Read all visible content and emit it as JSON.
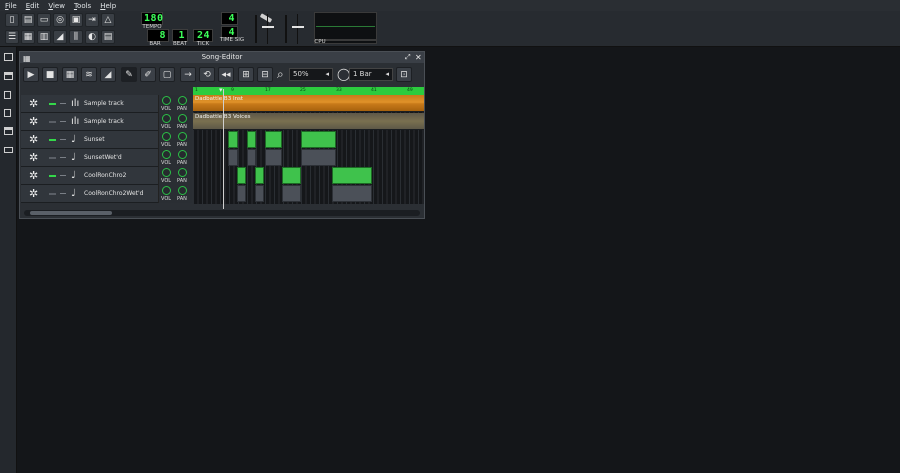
{
  "menu": [
    {
      "pre": "",
      "ul": "F",
      "post": "ile"
    },
    {
      "pre": "",
      "ul": "E",
      "post": "dit"
    },
    {
      "pre": "",
      "ul": "V",
      "post": "iew"
    },
    {
      "pre": "",
      "ul": "T",
      "post": "ools"
    },
    {
      "pre": "",
      "ul": "H",
      "post": "elp"
    }
  ],
  "toolbar": {
    "tempo": "180",
    "tempo_label": "TEMPO",
    "bar": "8",
    "beat": "1",
    "tick": "24",
    "bar_label": "BAR",
    "beat_label": "BEAT",
    "tick_label": "TICK",
    "timesig_num": "4",
    "timesig_den": "4",
    "timesig_label": "TIME SIG",
    "cpu_label": "CPU"
  },
  "song_editor": {
    "title": "Song-Editor",
    "zoom": "50%",
    "quantize": "1 Bar",
    "timeline_ticks": [
      "1",
      "9",
      "17",
      "25",
      "33",
      "41",
      "49"
    ],
    "tracks": [
      {
        "name": "Sample track",
        "icon": "waveform-icon",
        "muted": false
      },
      {
        "name": "Sample track",
        "icon": "waveform-icon",
        "muted": true
      },
      {
        "name": "Sunset",
        "icon": "note-icon",
        "muted": false
      },
      {
        "name": "SunsetWet'd",
        "icon": "note-icon",
        "muted": true
      },
      {
        "name": "CoolRonChro2",
        "icon": "note-icon",
        "muted": false
      },
      {
        "name": "CoolRonChro2Wet'd",
        "icon": "note-icon",
        "muted": true
      }
    ],
    "vol_label": "VOL",
    "pan_label": "PAN",
    "clip1": "Dadbattle B3 Inst",
    "clip2": "Dadbattle B3 Voices"
  },
  "colors": {
    "accent_green": "#2ccb3e",
    "sample_orange": "#c87a1a"
  }
}
